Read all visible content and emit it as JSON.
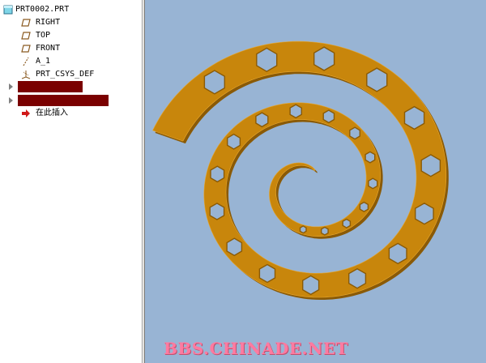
{
  "model_tree": {
    "root_label": "PRT0002.PRT",
    "items": [
      {
        "label": "RIGHT",
        "icon": "datum-plane-icon"
      },
      {
        "label": "TOP",
        "icon": "datum-plane-icon"
      },
      {
        "label": "FRONT",
        "icon": "datum-plane-icon"
      },
      {
        "label": "A_1",
        "icon": "datum-axis-icon"
      },
      {
        "label": "PRT_CSYS_DEF",
        "icon": "coordinate-system-icon"
      }
    ],
    "insert_here_label": "在此插入"
  },
  "viewport": {
    "background": "#98b4d4",
    "model_color": "#c8860c",
    "model_shade": "#8a5a06"
  },
  "watermark": "BBS.CHINADE.NET"
}
